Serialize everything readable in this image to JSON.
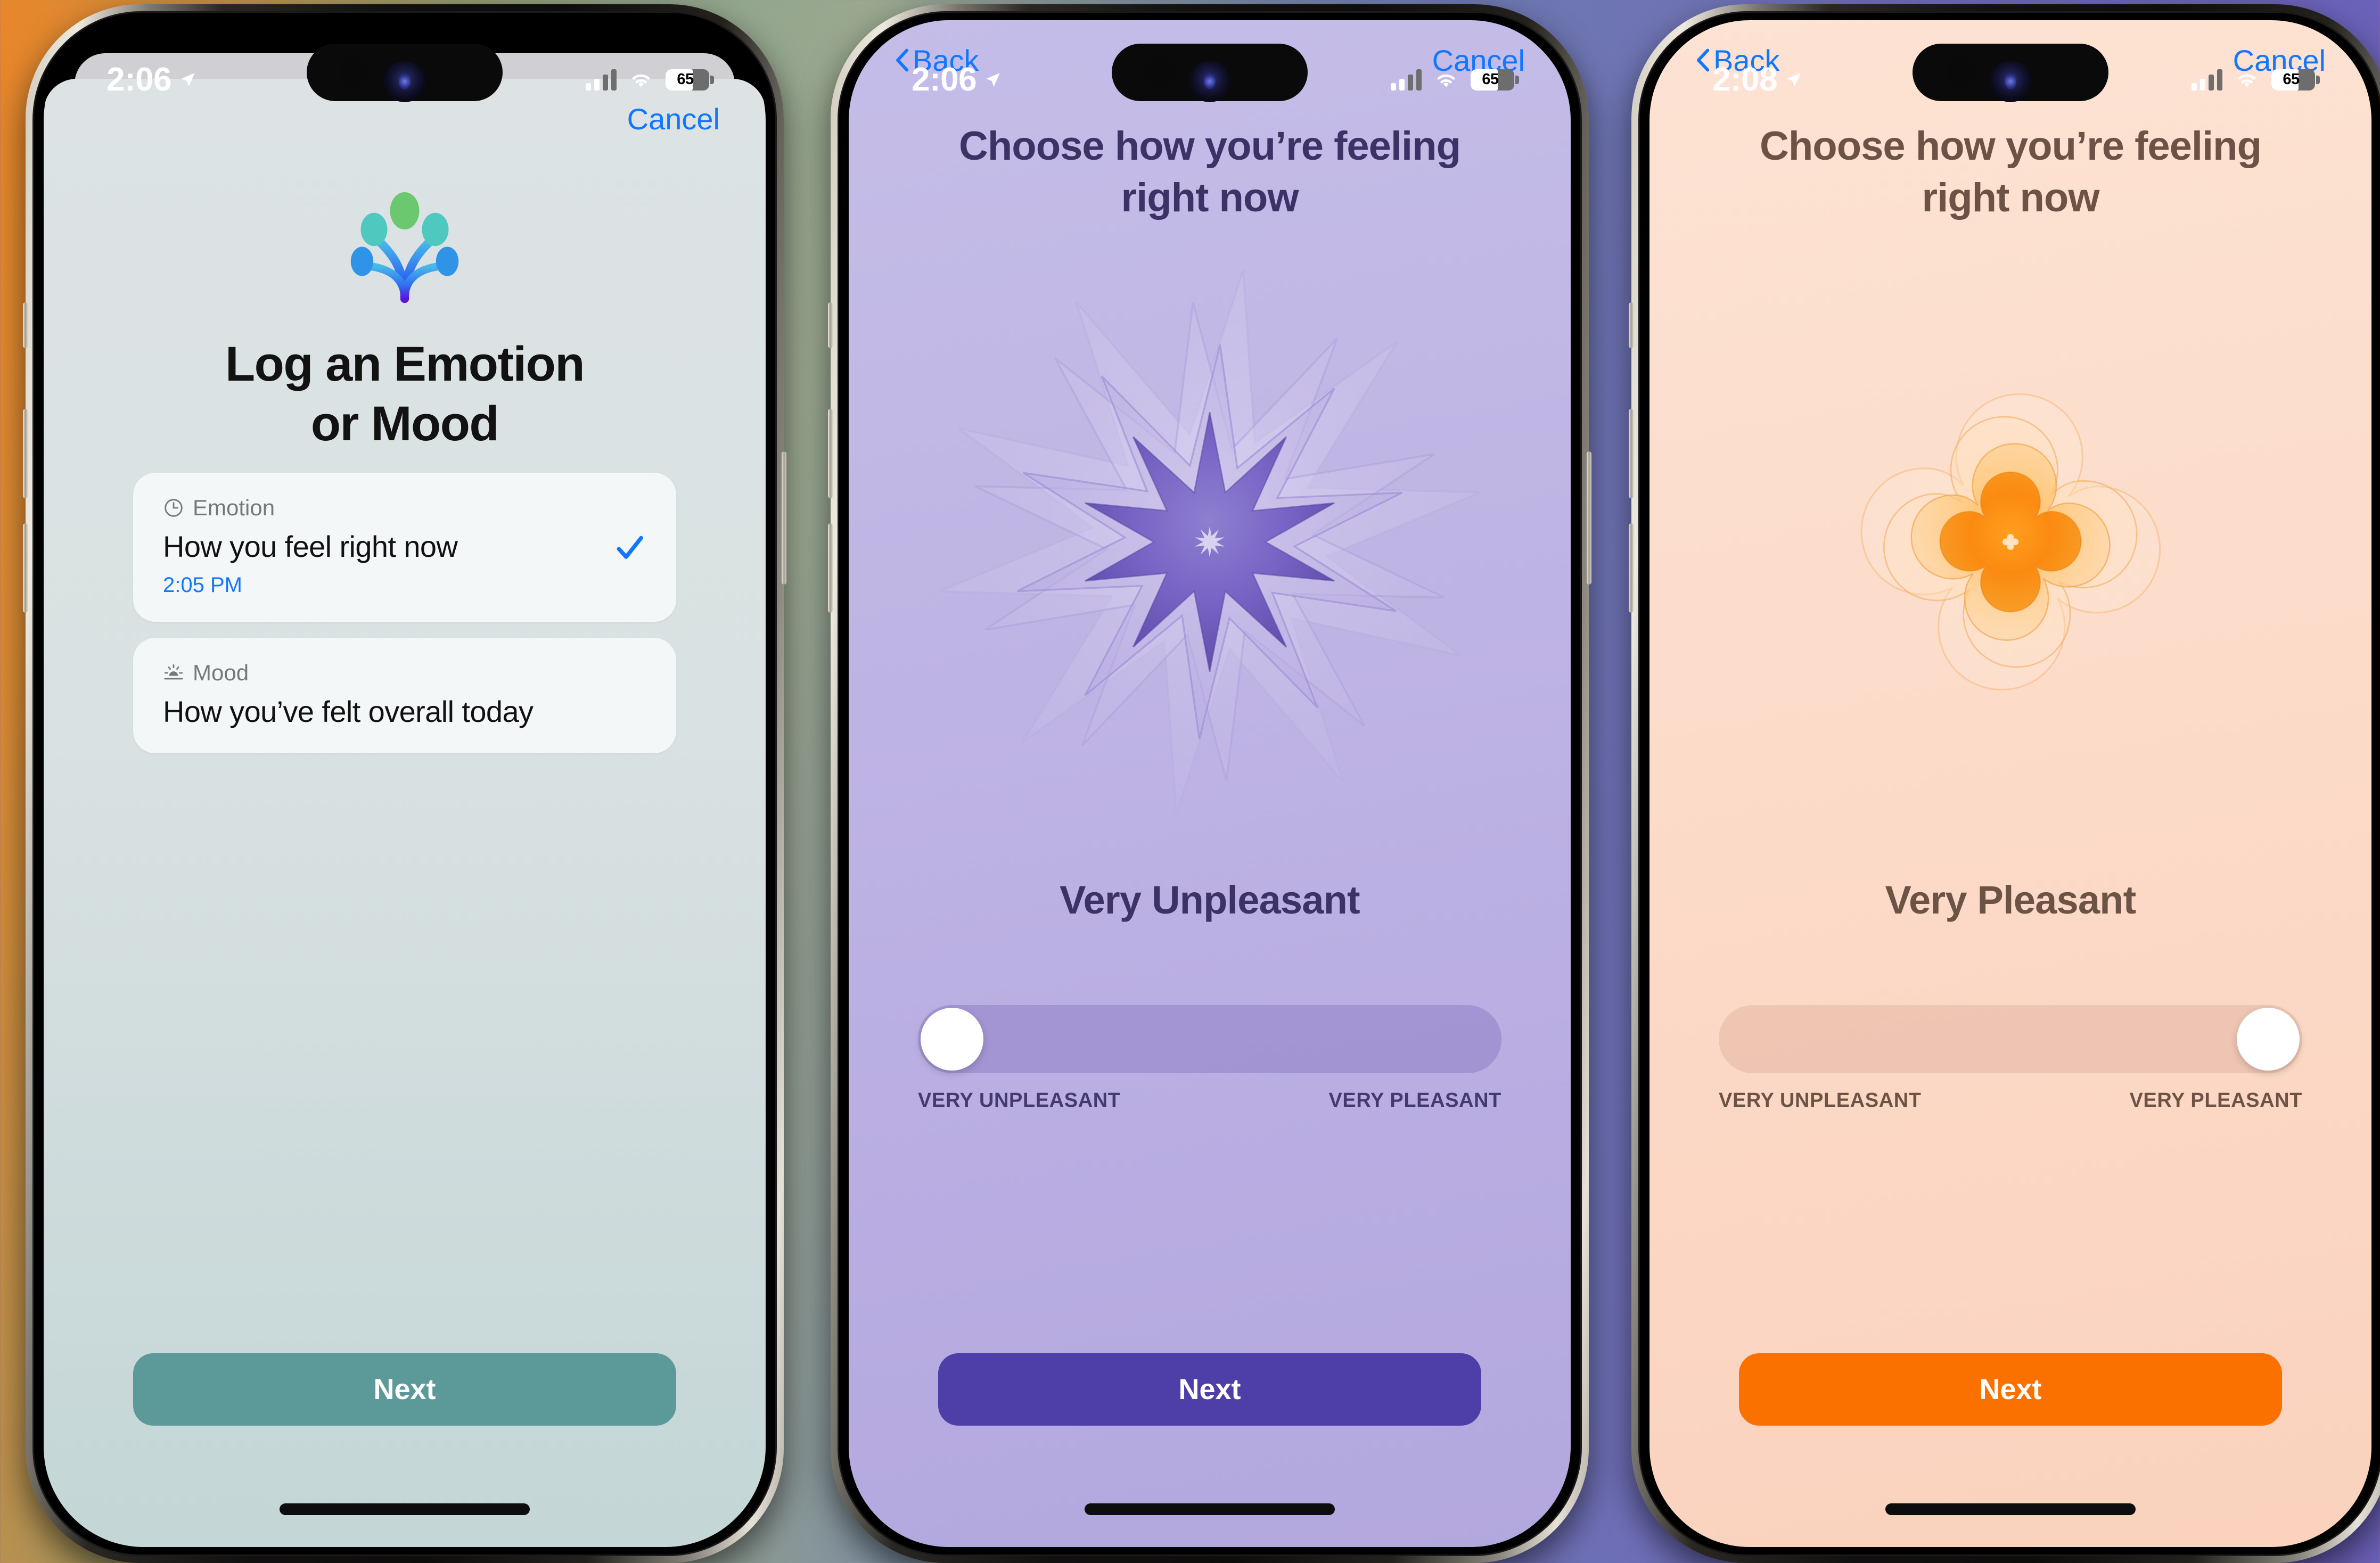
{
  "background": {
    "gradient_colors": [
      "#e8862a",
      "#93a68e",
      "#6a5fb6"
    ]
  },
  "phones": [
    {
      "id": "phone-1",
      "status_bar": {
        "time": "2:06",
        "battery": "65",
        "location_icon": "location-arrow-icon",
        "cellular_icon": "cellular-bars-icon",
        "wifi_icon": "wifi-icon",
        "battery_icon": "battery-icon"
      },
      "nav": {
        "left_label": "",
        "right_label": "Cancel",
        "has_back": false
      },
      "screen_type": "chooser",
      "hero_icon": "state-of-mind-burst-icon",
      "title": "Log an Emotion\nor Mood",
      "options": [
        {
          "kicker": "Emotion",
          "kicker_icon": "clock-icon",
          "title": "How you feel right now",
          "time": "2:05 PM",
          "selected": true
        },
        {
          "kicker": "Mood",
          "kicker_icon": "sunrise-icon",
          "title": "How you’ve felt overall today",
          "time": "",
          "selected": false
        }
      ],
      "cta": {
        "label": "Next",
        "color": "#5c9a9a",
        "style": "teal"
      },
      "theme": {
        "sheet_bg_top": "#dde3e4",
        "sheet_bg_bottom": "#c4d6d6",
        "card_bg": "#f4f7f8",
        "title_color": "#121212",
        "accent": "#1277ff"
      }
    },
    {
      "id": "phone-2",
      "status_bar": {
        "time": "2:06",
        "battery": "65",
        "location_icon": "location-arrow-icon",
        "cellular_icon": "cellular-bars-icon",
        "wifi_icon": "wifi-icon",
        "battery_icon": "battery-icon"
      },
      "nav": {
        "left_label": "Back",
        "right_label": "Cancel",
        "has_back": true
      },
      "screen_type": "valence-picker",
      "heading": "Choose how you’re feeling\nright now",
      "bloom_icon": "valence-bloom-unpleasant-icon",
      "valence_label": "Very Unpleasant",
      "slider": {
        "position": "left",
        "value_percent": 0,
        "min_label": "VERY UNPLEASANT",
        "max_label": "VERY PLEASANT"
      },
      "cta": {
        "label": "Next",
        "color": "#4e3ea8",
        "style": "purple"
      },
      "theme": {
        "bg_top": "#c5bde8",
        "bg_bottom": "#b3a8de",
        "text_color": "#3d3266",
        "accent": "#1277ff"
      }
    },
    {
      "id": "phone-3",
      "status_bar": {
        "time": "2:08",
        "battery": "65",
        "location_icon": "location-arrow-icon",
        "cellular_icon": "cellular-bars-icon",
        "wifi_icon": "wifi-icon",
        "battery_icon": "battery-icon"
      },
      "nav": {
        "left_label": "Back",
        "right_label": "Cancel",
        "has_back": true
      },
      "screen_type": "valence-picker",
      "heading": "Choose how you’re feeling\nright now",
      "bloom_icon": "valence-bloom-pleasant-icon",
      "valence_label": "Very Pleasant",
      "slider": {
        "position": "right",
        "value_percent": 100,
        "min_label": "VERY UNPLEASANT",
        "max_label": "VERY PLEASANT"
      },
      "cta": {
        "label": "Next",
        "color": "#fb7100",
        "style": "orange"
      },
      "theme": {
        "bg_top": "#fde3d4",
        "bg_bottom": "#fad2bd",
        "text_color": "#6d5346",
        "accent": "#1277ff"
      }
    }
  ]
}
